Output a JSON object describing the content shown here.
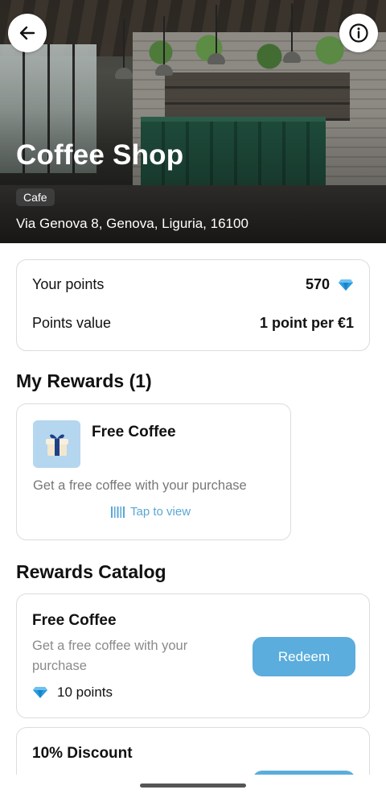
{
  "header": {
    "back_icon": "arrow-left-icon",
    "info_icon": "info-icon",
    "shop_name": "Coffee Shop",
    "category": "Cafe",
    "address": "Via Genova 8, Genova, Liguria, 16100"
  },
  "points": {
    "your_points_label": "Your points",
    "your_points_value": "570",
    "points_icon": "diamond-icon",
    "points_value_label": "Points value",
    "points_value_value": "1 point per €1"
  },
  "my_rewards": {
    "title": "My Rewards (1)",
    "items": [
      {
        "icon": "gift-box-icon",
        "title": "Free Coffee",
        "description": "Get a free coffee with your purchase",
        "action_label": "Tap to view",
        "action_icon": "barcode-icon"
      }
    ]
  },
  "catalog": {
    "title": "Rewards Catalog",
    "items": [
      {
        "title": "Free Coffee",
        "description": "Get a free coffee with your purchase",
        "points": "10 points",
        "button_label": "Redeem"
      },
      {
        "title": "10% Discount",
        "description": "",
        "points": "",
        "button_label": ""
      }
    ]
  },
  "colors": {
    "accent": "#5aaddc",
    "diamond": "#2a9be0",
    "muted_text": "#777777",
    "card_border": "#dcdcdc"
  }
}
